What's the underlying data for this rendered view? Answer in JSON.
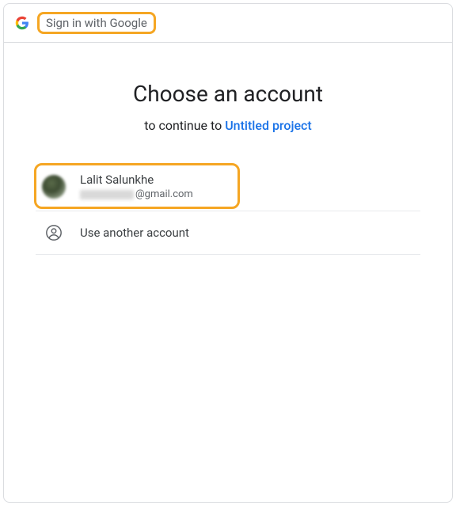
{
  "header": {
    "title": "Sign in with Google"
  },
  "main": {
    "heading": "Choose an account",
    "continue_prefix": "to continue to ",
    "project_name": "Untitled project"
  },
  "accounts": [
    {
      "name": "Lalit Salunkhe",
      "email_domain": "@gmail.com"
    }
  ],
  "another": {
    "label": "Use another account"
  }
}
